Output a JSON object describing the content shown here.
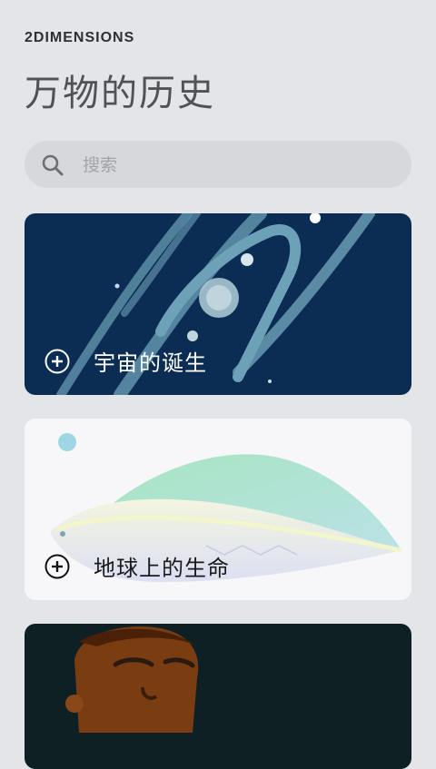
{
  "brand": "2DIMENSIONS",
  "page_title": "万物的历史",
  "search": {
    "placeholder": "搜索"
  },
  "cards": [
    {
      "label": "宇宙的诞生",
      "icon": "plus-circle-icon"
    },
    {
      "label": "地球上的生命",
      "icon": "plus-circle-icon"
    },
    {
      "label": "",
      "icon": "plus-circle-icon"
    }
  ],
  "colors": {
    "background": "#e4e5e9",
    "universe_card": "#0b2d54",
    "life_card": "#f7f7fa",
    "human_card": "#0e2024"
  }
}
